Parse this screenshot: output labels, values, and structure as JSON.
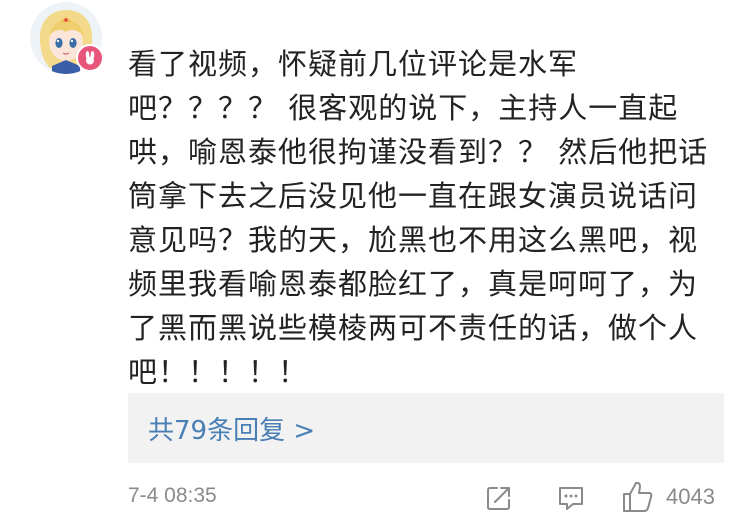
{
  "comment": {
    "lines": [
      "看了视频，怀疑前几位评论是水军",
      "吧？？？？ 很客观的说下，主持人一直起",
      "哄，喻恩泰他很拘谨没看到？？ 然后他把话",
      "筒拿下去之后没见他一直在跟女演员说话问",
      "意见吗？我的天，尬黑也不用这么黑吧，视",
      "频里我看喻恩泰都脸红了，真是呵呵了，为",
      "了黑而黑说些模棱两可不责任的话，做个人",
      "吧！！！！！"
    ]
  },
  "replies": {
    "label": "共79条回复 >"
  },
  "footer": {
    "timestamp": "7-4 08:35",
    "like_count": "4043"
  },
  "icons": {
    "avatar": "avatar-anime-girl",
    "badge": "bunny-badge-icon",
    "share": "share-icon",
    "comment": "comment-icon",
    "like": "thumbs-up-icon"
  },
  "colors": {
    "link": "#4a7fb5",
    "badge": "#e8557a",
    "reply_bg": "#f2f2f2",
    "meta_text": "#8a8a8a"
  }
}
